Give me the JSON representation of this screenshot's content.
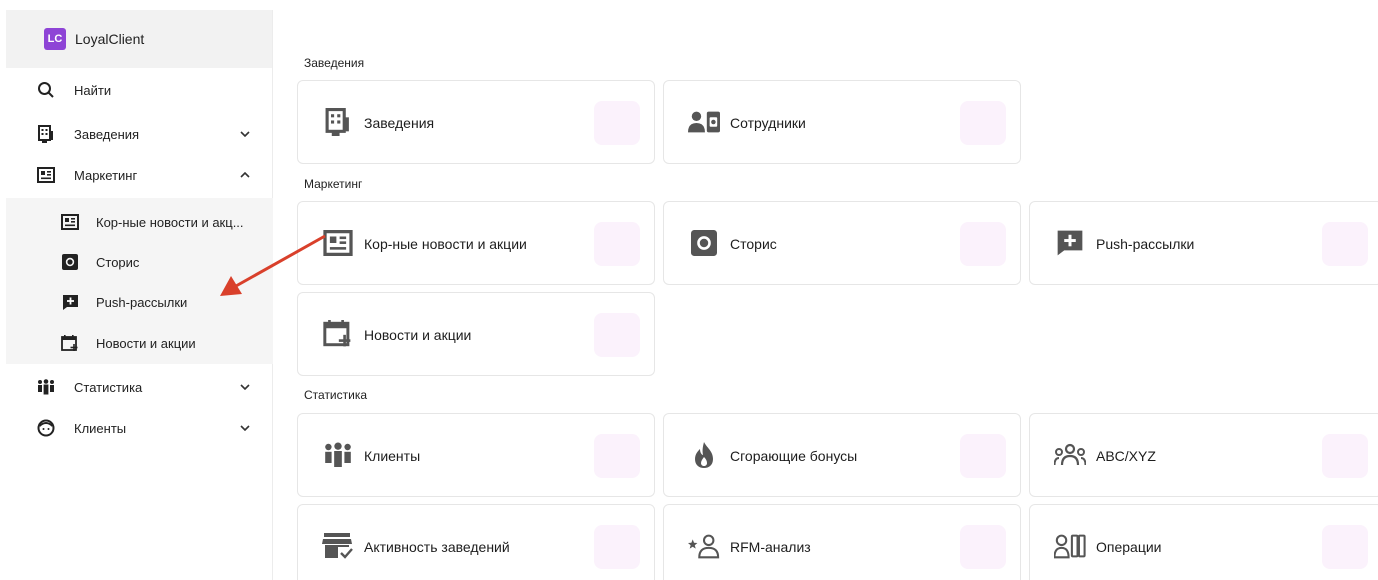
{
  "brand": {
    "logo": "LC",
    "name": "LoyalClient"
  },
  "sidebar": {
    "items": [
      {
        "label": "Найти",
        "icon": "search-icon"
      },
      {
        "label": "Заведения",
        "icon": "building-icon",
        "chevron": "chevron-down-icon"
      },
      {
        "label": "Маркетинг",
        "icon": "newspaper-icon",
        "chevron": "chevron-up-icon"
      },
      {
        "label": "Статистика",
        "icon": "people-group-icon",
        "chevron": "chevron-down-icon"
      },
      {
        "label": "Клиенты",
        "icon": "face-icon",
        "chevron": "chevron-down-icon"
      }
    ],
    "marketing_sub": [
      {
        "label": "Кор-ные новости и акц...",
        "icon": "newspaper-icon"
      },
      {
        "label": "Сторис",
        "icon": "stories-icon"
      },
      {
        "label": "Push-рассылки",
        "icon": "chat-plus-icon"
      },
      {
        "label": "Новости и акции",
        "icon": "calendar-plus-icon"
      }
    ]
  },
  "main": {
    "sections": [
      {
        "title": "Заведения",
        "cards": [
          {
            "label": "Заведения",
            "icon": "building-icon"
          },
          {
            "label": "Сотрудники",
            "icon": "employee-badge-icon"
          }
        ]
      },
      {
        "title": "Маркетинг",
        "cards": [
          {
            "label": "Кор-ные новости и акции",
            "icon": "newspaper-icon"
          },
          {
            "label": "Сторис",
            "icon": "stories-icon"
          },
          {
            "label": "Push-рассылки",
            "icon": "chat-plus-icon"
          },
          {
            "label": "Новости и акции",
            "icon": "calendar-plus-icon"
          }
        ]
      },
      {
        "title": "Статистика",
        "cards": [
          {
            "label": "Клиенты",
            "icon": "people-group-icon"
          },
          {
            "label": "Сгорающие бонусы",
            "icon": "flame-icon"
          },
          {
            "label": "ABC/XYZ",
            "icon": "team-icon"
          },
          {
            "label": "Активность заведений",
            "icon": "store-check-icon"
          },
          {
            "label": "RFM-анализ",
            "icon": "star-person-icon"
          },
          {
            "label": "Операции",
            "icon": "person-columns-icon"
          }
        ]
      }
    ]
  },
  "colors": {
    "brand": "#8e44d6",
    "annotation_arrow": "#d9402b",
    "ghost_icon": "#fbf2fc"
  }
}
